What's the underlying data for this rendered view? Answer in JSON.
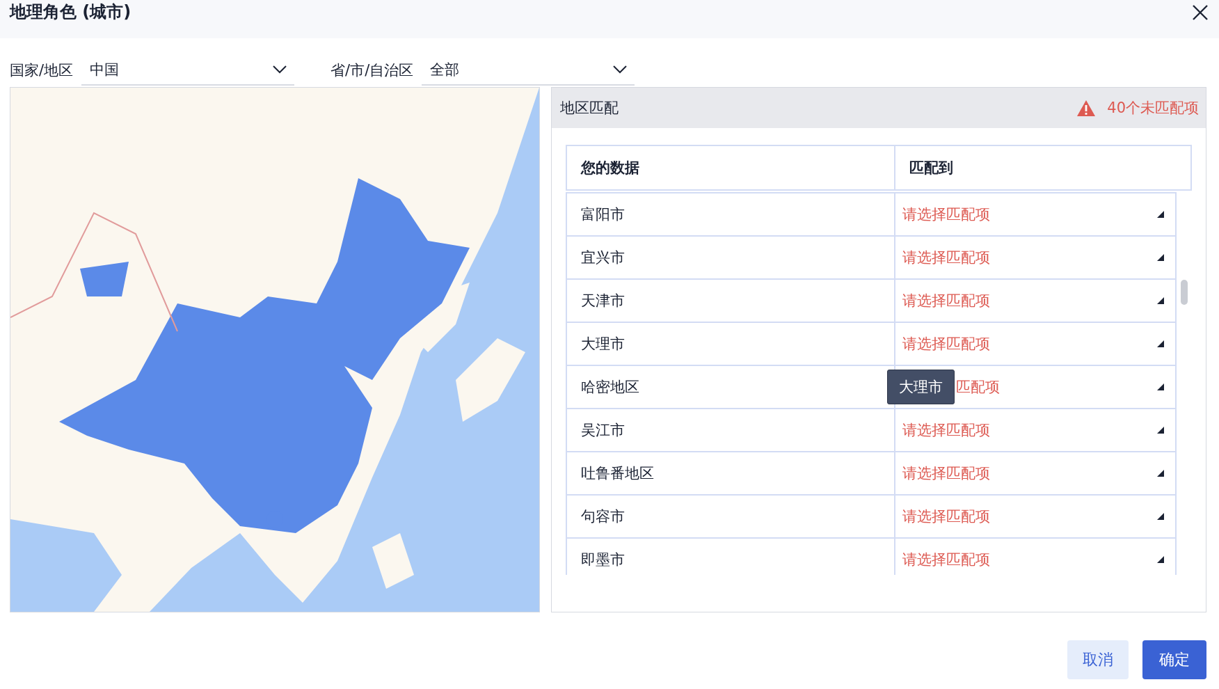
{
  "dialog": {
    "title": "地理角色 (城市)"
  },
  "filters": [
    {
      "label": "国家/地区",
      "value": "中国"
    },
    {
      "label": "省/市/自治区",
      "value": "全部"
    }
  ],
  "matching": {
    "title": "地区匹配",
    "warning": "40个未匹配项",
    "columns": [
      "您的数据",
      "匹配到"
    ],
    "rows": [
      {
        "data": "富阳市",
        "match": "请选择匹配项"
      },
      {
        "data": "宜兴市",
        "match": "请选择匹配项"
      },
      {
        "data": "天津市",
        "match": "请选择匹配项"
      },
      {
        "data": "大理市",
        "match": "请选择匹配项"
      },
      {
        "data": "哈密地区",
        "match": "匹配项",
        "tooltip": "大理市"
      },
      {
        "data": "吴江市",
        "match": "请选择匹配项"
      },
      {
        "data": "吐鲁番地区",
        "match": "请选择匹配项"
      },
      {
        "data": "句容市",
        "match": "请选择匹配项"
      },
      {
        "data": "即墨市",
        "match": "请选择匹配项"
      }
    ]
  },
  "buttons": [
    {
      "label": "取消",
      "kind": "secondary"
    },
    {
      "label": "确定",
      "kind": "primary"
    }
  ]
}
